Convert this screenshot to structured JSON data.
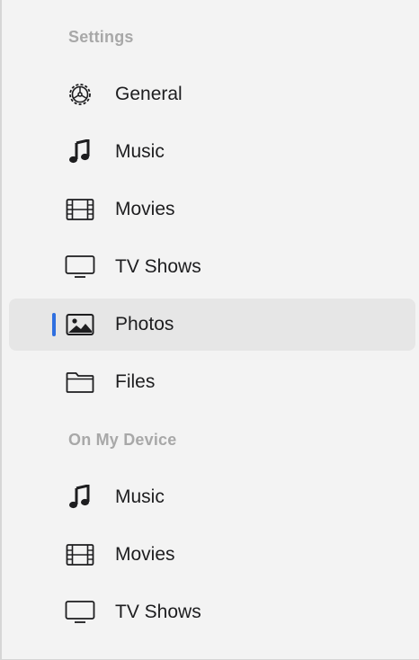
{
  "sections": [
    {
      "header": "Settings",
      "items": [
        {
          "label": "General",
          "icon": "gear-icon"
        },
        {
          "label": "Music",
          "icon": "music-note-icon"
        },
        {
          "label": "Movies",
          "icon": "film-icon"
        },
        {
          "label": "TV Shows",
          "icon": "tv-icon"
        },
        {
          "label": "Photos",
          "icon": "photo-icon",
          "selected": true
        },
        {
          "label": "Files",
          "icon": "folder-icon"
        }
      ]
    },
    {
      "header": "On My Device",
      "items": [
        {
          "label": "Music",
          "icon": "music-note-icon"
        },
        {
          "label": "Movies",
          "icon": "film-icon"
        },
        {
          "label": "TV Shows",
          "icon": "tv-icon"
        }
      ]
    }
  ],
  "colors": {
    "accent": "#2f6fe0",
    "selected_bg": "#e6e6e6",
    "sidebar_bg": "#f3f3f3",
    "header_text": "#a8a8a8",
    "item_text": "#1d1d1f"
  }
}
